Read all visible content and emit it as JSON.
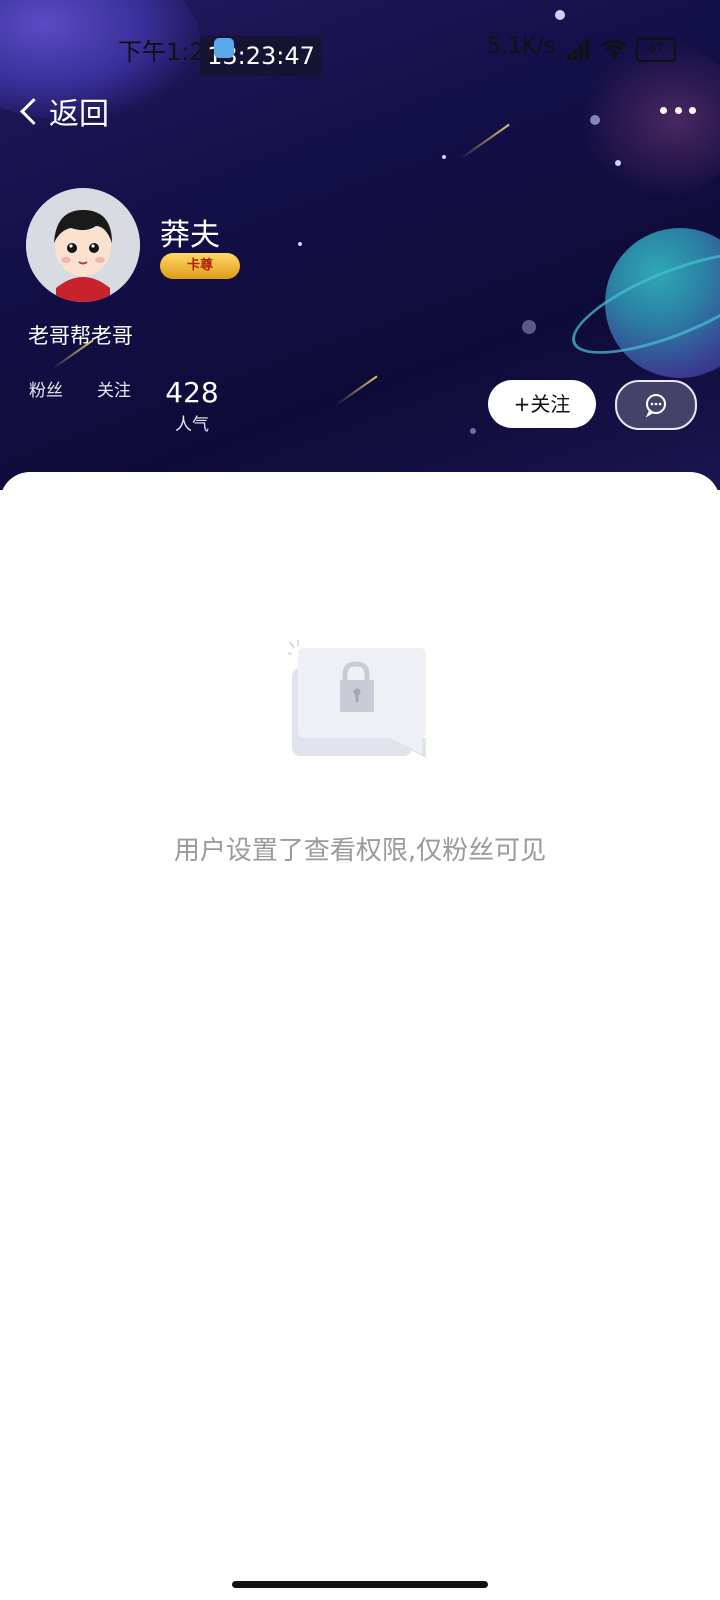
{
  "status_bar": {
    "time": "下午1:23",
    "clock_overlay": "13:23:47",
    "network_speed": "5.1K/s",
    "battery": "67"
  },
  "nav": {
    "back_label": "返回",
    "back_icon": "chevron-left-icon",
    "more_icon": "more-dots-icon"
  },
  "profile": {
    "username": "莽夫",
    "badge_label": "卡尊",
    "bio": "老哥帮老哥",
    "stats": [
      {
        "label": "粉丝",
        "value": ""
      },
      {
        "label": "关注",
        "value": ""
      },
      {
        "label": "人气",
        "value": "428"
      }
    ]
  },
  "actions": {
    "follow_label": "+关注",
    "message_icon": "chat-bubble-icon"
  },
  "content": {
    "empty_icon": "lock-icon",
    "empty_message": "用户设置了查看权限,仅粉丝可见"
  },
  "colors": {
    "header_bg": "#14104a",
    "follow_bg": "#ffffff",
    "message_bg": "#45426a",
    "empty_text": "#9a9a9a"
  }
}
